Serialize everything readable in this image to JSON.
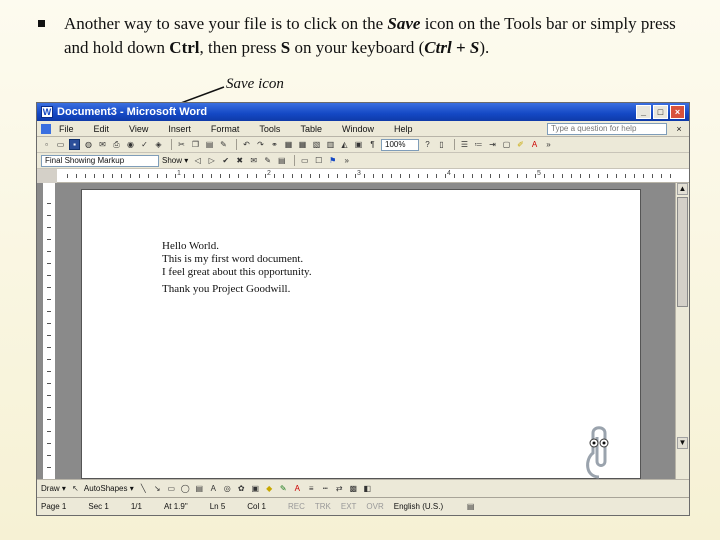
{
  "slide": {
    "bullet_parts": [
      "Another way to save your file is to click on the ",
      "Save",
      " icon on the Tools bar or simply press and hold down ",
      "Ctrl",
      ", then press ",
      "S",
      " on your keyboard (",
      "Ctrl + S",
      ")."
    ],
    "save_caption": "Save icon"
  },
  "window": {
    "title": "Document3 - Microsoft Word",
    "buttons": {
      "minimize": "_",
      "maximize": "□",
      "close": "×"
    }
  },
  "menu": {
    "items": [
      "File",
      "Edit",
      "View",
      "Insert",
      "Format",
      "Tools",
      "Table",
      "Window",
      "Help"
    ],
    "help_placeholder": "Type a question for help",
    "close_doc": "×"
  },
  "toolbar": {
    "zoom": "100%",
    "markup_select": "Final Showing Markup",
    "show_label": "Show ▾"
  },
  "ruler": {
    "numbers": [
      "1",
      "2",
      "3",
      "4",
      "5"
    ]
  },
  "document": {
    "lines": [
      "Hello World.",
      "This is my first word document.",
      "I feel great about this opportunity.",
      "",
      "Thank you Project Goodwill."
    ]
  },
  "drawbar": {
    "draw_label": "Draw ▾",
    "autoshapes_label": "AutoShapes ▾"
  },
  "status": {
    "page": "Page 1",
    "sec": "Sec 1",
    "pages": "1/1",
    "at": "At 1.9\"",
    "ln": "Ln 5",
    "col": "Col 1",
    "rec": "REC",
    "trk": "TRK",
    "ext": "EXT",
    "ovr": "OVR",
    "language": "English (U.S.)"
  }
}
